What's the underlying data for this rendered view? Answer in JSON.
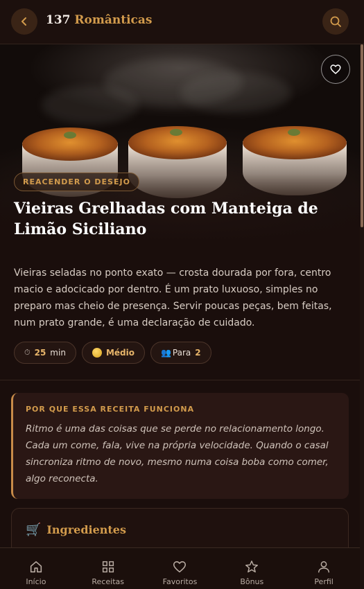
{
  "header": {
    "count": "137",
    "category": "Românticas",
    "back_icon": "chevron-left-icon",
    "search_icon": "search-icon"
  },
  "hero": {
    "favorite_icon": "heart-icon",
    "tag": "REACENDER O DESEJO",
    "title": "Vieiras Grelhadas com Manteiga de Limão Siciliano"
  },
  "description": "Vieiras seladas no ponto exato — crosta dourada por fora, centro macio e adocicado por dentro. É um prato luxuoso, simples no preparo mas cheio de presença. Servir poucas peças, bem feitas, num prato grande, é uma declaração de cuidado.",
  "chips": {
    "time": {
      "icon": "⏱",
      "value": "25",
      "unit": "min"
    },
    "difficulty": {
      "value": "Médio"
    },
    "serves": {
      "icon": "👥",
      "label": "Para",
      "value": "2"
    }
  },
  "why": {
    "label": "POR QUE ESSA RECEITA FUNCIONA",
    "text": "Ritmo é uma das coisas que se perde no relacionamento longo. Cada um come, fala, vive na própria velocidade. Quando o casal sincroniza ritmo de novo, mesmo numa coisa boba como comer, algo reconecta."
  },
  "ingredients": {
    "icon": "🛒",
    "title": "Ingredientes"
  },
  "nav": {
    "items": [
      {
        "label": "Início",
        "icon": "home-icon"
      },
      {
        "label": "Receitas",
        "icon": "grid-icon"
      },
      {
        "label": "Favoritos",
        "icon": "heart-icon"
      },
      {
        "label": "Bônus",
        "icon": "star-icon"
      },
      {
        "label": "Perfil",
        "icon": "user-icon"
      }
    ]
  },
  "colors": {
    "background": "#1a0e0c",
    "accent": "#d29b4c",
    "card": "#2a1714"
  }
}
